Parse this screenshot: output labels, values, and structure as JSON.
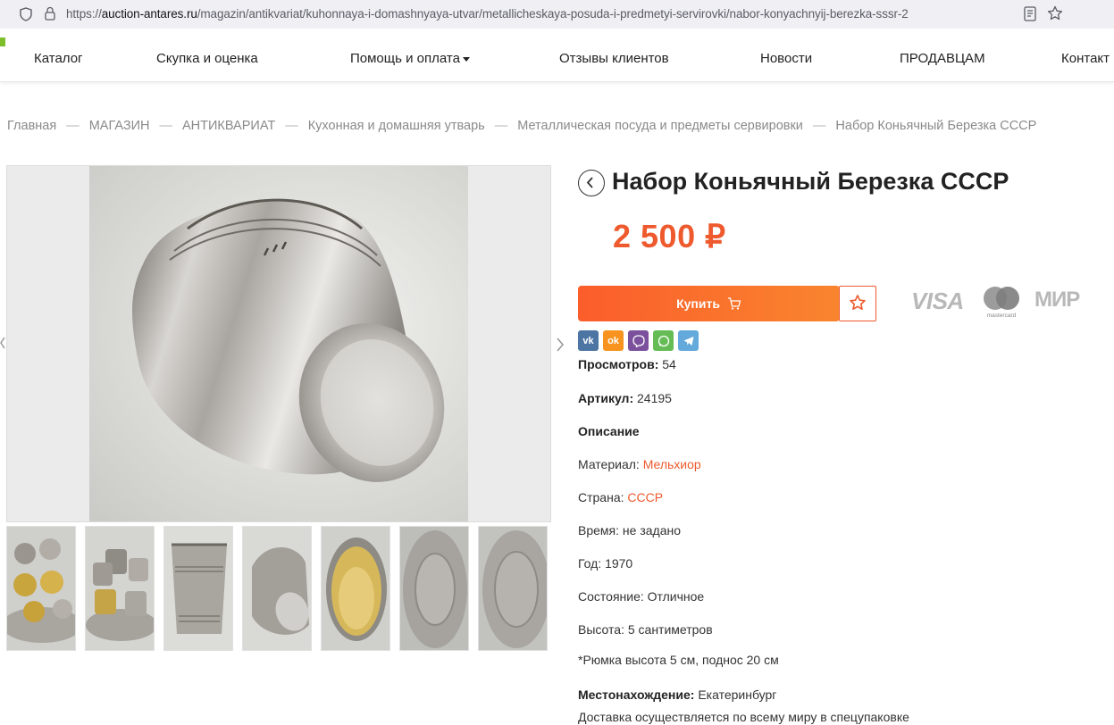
{
  "browser": {
    "url_prefix": "https://",
    "url_domain": "auction-antares.ru",
    "url_path": "/magazin/antikvariat/kuhonnaya-i-domashnyaya-utvar/metallicheskaya-posuda-i-predmetyi-servirovki/nabor-konyachnyij-berezka-sssr-2"
  },
  "nav": {
    "items": [
      "Каталог",
      "Скупка и оценка",
      "Помощь и оплата",
      "Отзывы клиентов",
      "Новости",
      "ПРОДАВЦАМ",
      "Контакт"
    ]
  },
  "breadcrumb": [
    "Главная",
    "МАГАЗИН",
    "АНТИКВАРИАТ",
    "Кухонная и домашняя утварь",
    "Металлическая посуда и предметы сервировки",
    "Набор Коньячный Березка СССР"
  ],
  "product": {
    "title": "Набор Коньячный Березка СССР",
    "price": "2 500 ₽",
    "buy_label": "Купить",
    "payment": {
      "visa": "VISA",
      "mastercard": "mastercard",
      "mir": "МИР"
    },
    "share": [
      "vk",
      "odnoklassniki",
      "viber",
      "whatsapp",
      "telegram"
    ],
    "views_label": "Просмотров:",
    "views": "54",
    "sku_label": "Артикул:",
    "sku": "24195",
    "description_label": "Описание",
    "material_label": "Материал:",
    "material": "Мельхиор",
    "country_label": "Страна:",
    "country": "СССР",
    "time_label": "Время:",
    "time": "не задано",
    "year_label": "Год:",
    "year": "1970",
    "condition_label": "Состояние:",
    "condition": "Отличное",
    "height_label": "Высота:",
    "height": "5 сантиметров",
    "note": "*Рюмка высота 5 см, поднос 20 см",
    "location_label": "Местонахождение:",
    "location": "Екатеринбург",
    "delivery": "Доставка осуществляется по всему миру в спецупаковке"
  },
  "colors": {
    "accent": "#ee5a2d",
    "buy_start": "#fb5d2b",
    "buy_end": "#f9852e"
  }
}
